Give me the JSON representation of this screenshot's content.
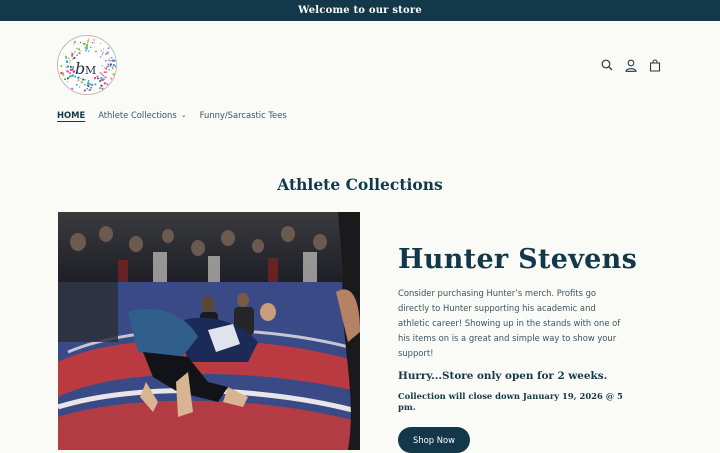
{
  "announcement": "Welcome to our store",
  "logo": {
    "monogram_b": "b",
    "monogram_m": "M"
  },
  "header_icons": [
    "search-icon",
    "account-icon",
    "cart-icon"
  ],
  "nav": [
    {
      "label": "HOME",
      "active": true
    },
    {
      "label": "Athlete Collections",
      "dropdown": true
    },
    {
      "label": "Funny/Sarcastic Tees"
    }
  ],
  "section": {
    "title": "Athlete Collections"
  },
  "feature": {
    "name": "Hunter Stevens",
    "description": "Consider purchasing Hunter’s merch. Profits go directly to Hunter supporting his academic and athletic career! Showing up in the stands with one of his items on is a great and simple way to show your support!",
    "hurry": "Hurry...Store only open for 2 weeks.",
    "closing": "Collection will close down January 19, 2026 @ 5 pm.",
    "button": "Shop Now"
  },
  "colors": {
    "primary": "#123849",
    "background": "#fafbf7",
    "text": "#3d5560"
  }
}
